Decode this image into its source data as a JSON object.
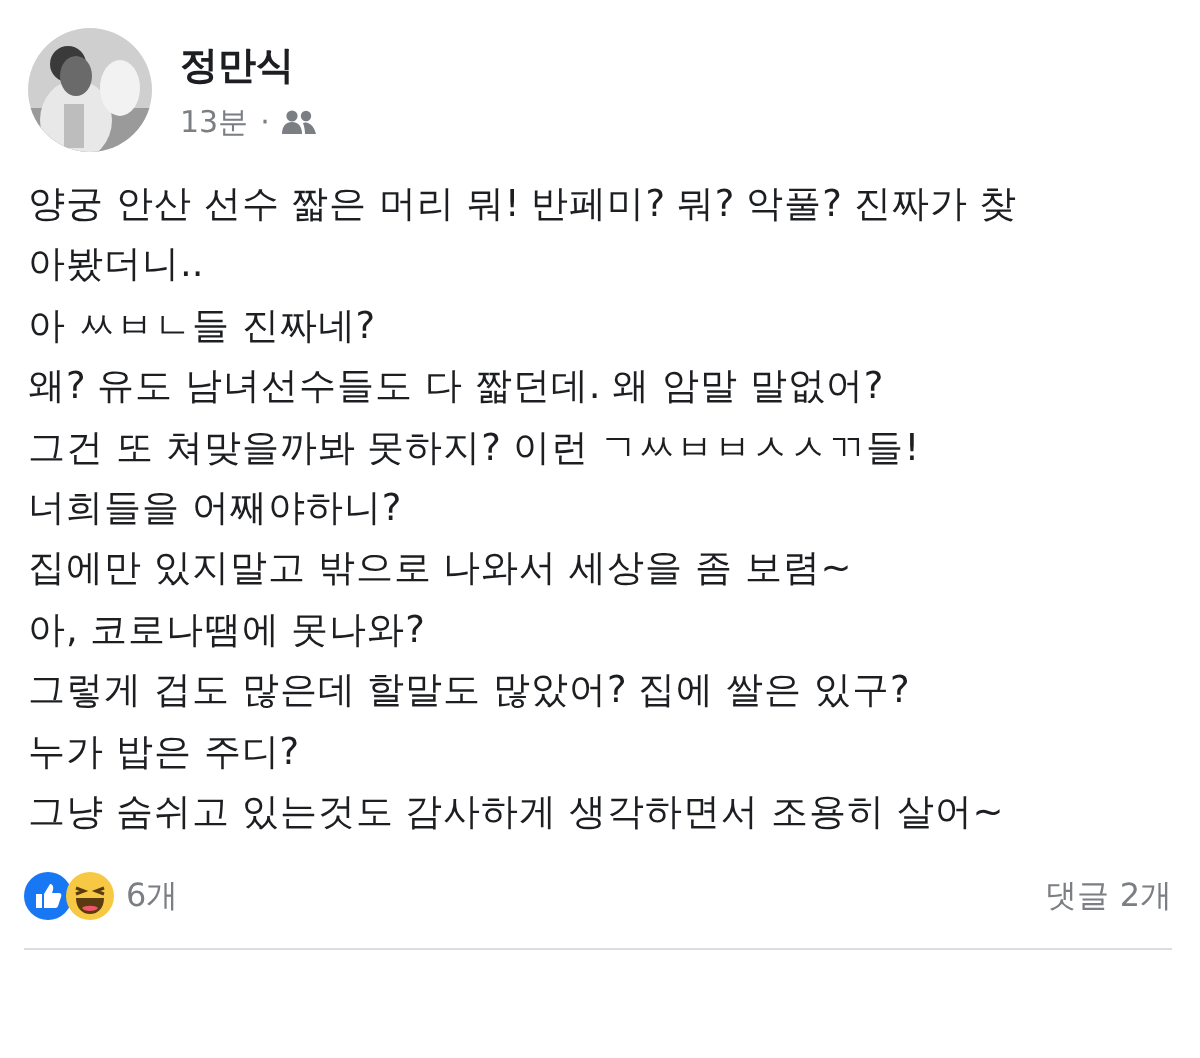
{
  "post": {
    "author": "정만식",
    "time": "13분",
    "separator": "·",
    "lines": [
      "양궁 안산 선수 짧은 머리 뭐! 반페미? 뭐? 악풀? 진짜가 찾",
      "아봤더니..",
      "아 ㅆㅂㄴ들 진짜네?",
      "왜? 유도 남녀선수들도 다 짧던데. 왜 암말 말없어?",
      "그건 또 쳐맞을까봐 못하지? 이런 ㄱㅆㅂㅂㅅㅅㄲ들!",
      "너희들을 어째야하니?",
      "집에만 있지말고 밖으로 나와서 세상을 좀 보렴~",
      "아, 코로나땜에 못나와?",
      "그렇게 겁도 많은데 할말도 많았어? 집에 쌀은 있구?",
      "누가 밥은 주디?",
      "그냥 숨쉬고 있는것도 감사하게 생각하면서 조용히 살어~"
    ],
    "reactions": {
      "count": "6개"
    },
    "comments": "댓글 2개"
  }
}
